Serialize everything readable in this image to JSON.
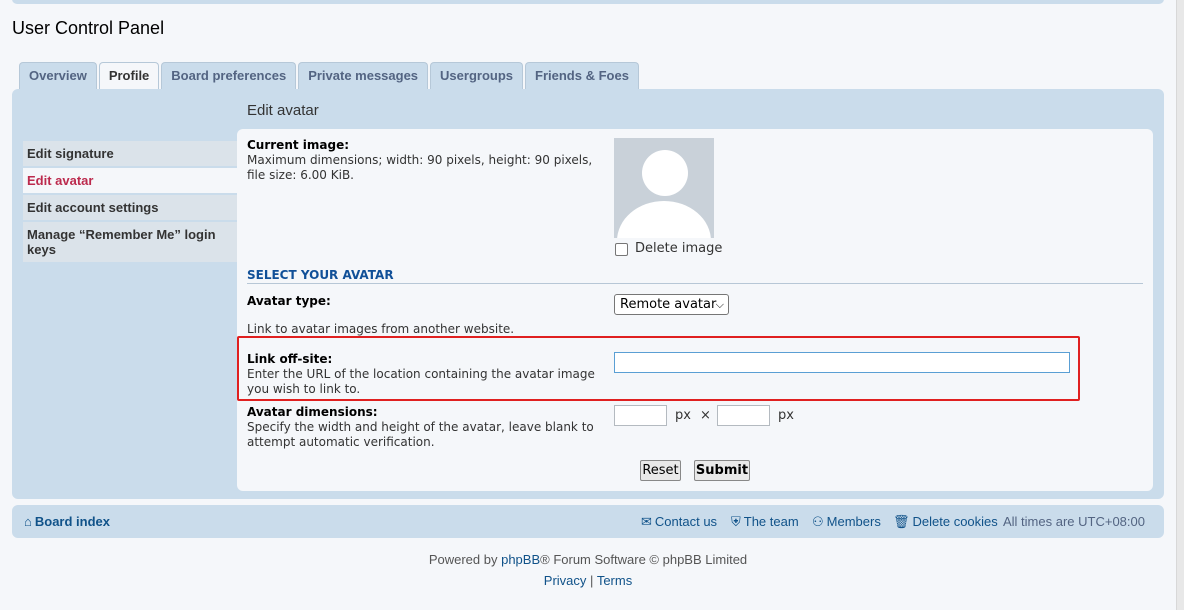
{
  "page": {
    "title": "User Control Panel"
  },
  "tabs": [
    {
      "label": "Overview"
    },
    {
      "label": "Profile",
      "active": true
    },
    {
      "label": "Board preferences"
    },
    {
      "label": "Private messages"
    },
    {
      "label": "Usergroups"
    },
    {
      "label": "Friends & Foes"
    }
  ],
  "sidebar": {
    "items": [
      {
        "label": "Edit signature"
      },
      {
        "label": "Edit avatar",
        "active": true
      },
      {
        "label": "Edit account settings"
      },
      {
        "label": "Manage “Remember Me” login keys"
      }
    ]
  },
  "main": {
    "heading": "Edit avatar",
    "current_image": {
      "label": "Current image:",
      "desc": "Maximum dimensions; width: 90 pixels, height: 90 pixels, file size: 6.00 KiB.",
      "delete_label": "Delete image"
    },
    "select_heading": "SELECT YOUR AVATAR",
    "avatar_type": {
      "label": "Avatar type:",
      "selected": "Remote avatar",
      "help": "Link to avatar images from another website."
    },
    "link_offsite": {
      "label": "Link off-site:",
      "desc": "Enter the URL of the location containing the avatar image you wish to link to.",
      "value": ""
    },
    "dimensions": {
      "label": "Avatar dimensions:",
      "desc": "Specify the width and height of the avatar, leave blank to attempt automatic verification.",
      "unit": "px",
      "times": "×",
      "width": "",
      "height": ""
    },
    "buttons": {
      "reset": "Reset",
      "submit": "Submit"
    }
  },
  "footer": {
    "board_index": "Board index",
    "contact": "Contact us",
    "team": "The team",
    "members": "Members",
    "delete_cookies": "Delete cookies",
    "timezone": "All times are UTC+08:00"
  },
  "credits": {
    "powered_by": "Powered by",
    "phpbb": "phpBB",
    "rest": "® Forum Software © phpBB Limited",
    "privacy": "Privacy",
    "sep": "|",
    "terms": "Terms"
  },
  "colors": {
    "accent": "#105289",
    "panel_bg": "#cadceb",
    "content_bg": "#f5f7fa",
    "active_menu": "#bc2a4d",
    "highlight_rect": "#e02020"
  }
}
